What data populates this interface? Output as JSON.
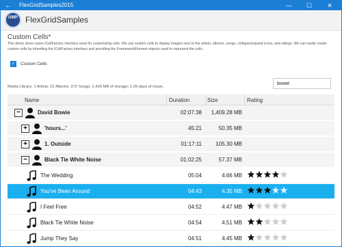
{
  "window": {
    "title": "FlexGridSamples2015",
    "back_glyph": "←",
    "minimize_glyph": "—",
    "maximize_glyph": "☐",
    "close_glyph": "✕"
  },
  "app": {
    "logo_text": "UWP",
    "name": "FlexGridSamples"
  },
  "page": {
    "heading": "Custom Cells*",
    "description": "This demo show cases ICellFactory interface used for customizing cells. We use custom cells to display images next to the artists, albums, songs, collapse/expand icons, and ratings. We can easily create custom cells by inheriting the ICellFactory interface and providing the FrameworkElement objects used to represent the cells.",
    "checkbox_label": "Custom Cells",
    "checkbox_checked": true,
    "search_value": "bowie",
    "summary": "Media Library: 1 Artists; 22 Albums; 272 Songs; 1,409 MB of storage; 1.09 days of music."
  },
  "grid": {
    "columns": [
      "Name",
      "Duration",
      "Size",
      "Rating"
    ],
    "rows": [
      {
        "kind": "artist",
        "expander": "−",
        "name": "David Bowie",
        "duration": "02:07:38",
        "size": "1,409.28 MB"
      },
      {
        "kind": "album",
        "expander": "+",
        "name": "'hours...'",
        "duration": "45:21",
        "size": "50.35 MB"
      },
      {
        "kind": "album",
        "expander": "+",
        "name": "1. Outside",
        "duration": "01:17:11",
        "size": "105.30 MB"
      },
      {
        "kind": "album",
        "expander": "−",
        "name": "Black Tie White Noise",
        "duration": "01:02:25",
        "size": "57.37 MB"
      },
      {
        "kind": "song",
        "name": "The Wedding",
        "duration": "05:04",
        "size": "4.66 MB",
        "rating": 4
      },
      {
        "kind": "song",
        "name": "You've Been Around",
        "duration": "04:43",
        "size": "4.35 MB",
        "rating": 3,
        "selected": true
      },
      {
        "kind": "song",
        "name": "I Feel Free",
        "duration": "04:52",
        "size": "4.47 MB",
        "rating": 1
      },
      {
        "kind": "song",
        "name": "Black Tie White Noise",
        "duration": "04:54",
        "size": "4.51 MB",
        "rating": 2
      },
      {
        "kind": "song",
        "name": "Jump They Say",
        "duration": "04:51",
        "size": "4.45 MB",
        "rating": 1
      }
    ]
  },
  "colors": {
    "accent": "#1c7fd6",
    "selection": "#1ab0f0",
    "star_filled": "#111111",
    "star_empty": "#cccccc",
    "star_filled_selected": "#111111",
    "star_empty_selected": "#d8eef8"
  },
  "icons": {
    "artist": "person-icon",
    "album": "person-icon",
    "song": "music-note-icon",
    "rating": "star-icon"
  }
}
